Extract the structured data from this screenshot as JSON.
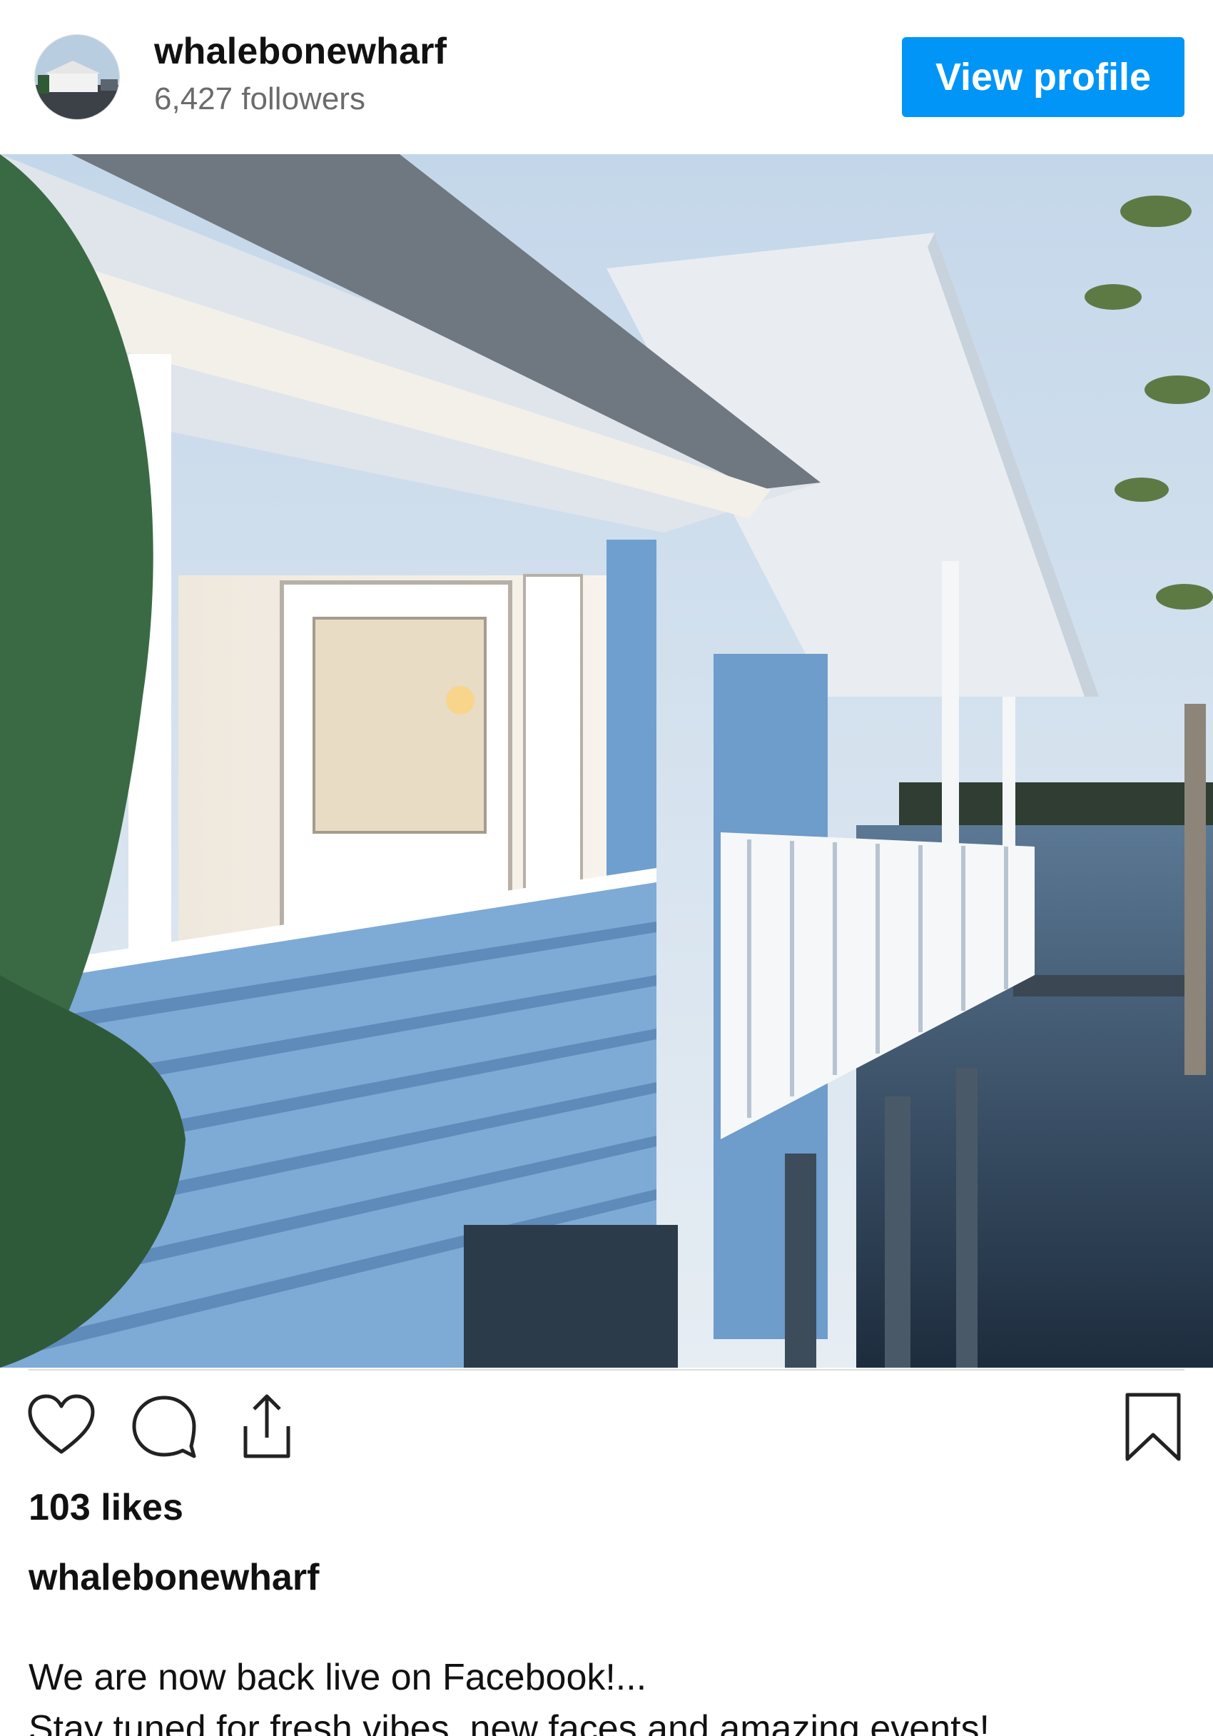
{
  "header": {
    "username": "whalebonewharf",
    "followers": "6,427 followers",
    "view_profile_label": "View profile"
  },
  "photo": {
    "alt": "Blue painted wharf building over water at dusk"
  },
  "actions": {
    "like_icon": "heart-icon",
    "comment_icon": "comment-icon",
    "share_icon": "share-icon",
    "save_icon": "bookmark-icon"
  },
  "post": {
    "likes": "103 likes",
    "caption_username": "whalebonewharf",
    "caption_lines": [
      "We are now back live on Facebook!...",
      "Stay tuned for fresh vibes, new faces and amazing events!"
    ]
  },
  "colors": {
    "accent": "#0095f6",
    "text": "#111111",
    "muted": "#6b6b6b"
  }
}
